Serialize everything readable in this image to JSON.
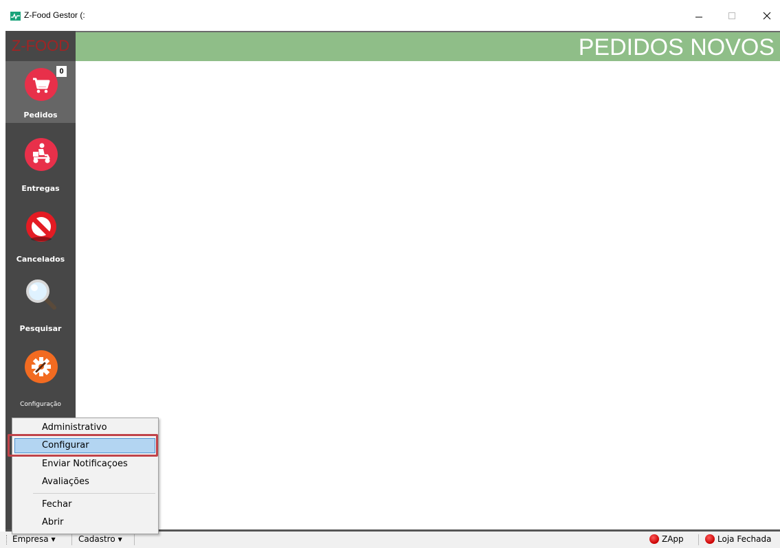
{
  "window": {
    "title": "Z-Food Gestor (:"
  },
  "brand": "Z-FOOD",
  "header": {
    "title": "PEDIDOS NOVOS"
  },
  "sidebar": {
    "items": [
      {
        "label": "Pedidos",
        "icon": "cart-icon",
        "badge": "0",
        "active": true
      },
      {
        "label": "Entregas",
        "icon": "delivery-scooter-icon"
      },
      {
        "label": "Cancelados",
        "icon": "cancel-icon"
      },
      {
        "label": "Pesquisar",
        "icon": "magnifier-icon"
      },
      {
        "label": "Configuração",
        "icon": "gear-wrench-icon"
      }
    ]
  },
  "menu": {
    "items": [
      "Administrativo",
      "Configurar",
      "Enviar Notificaçoes",
      "Avaliações",
      "Fechar",
      "Abrir"
    ],
    "highlighted": "Configurar"
  },
  "statusbar": {
    "empresa": "Empresa",
    "cadastro": "Cadastro",
    "zapp": "ZApp",
    "loja": "Loja Fechada"
  },
  "colors": {
    "header_bg": "#8fbe88",
    "sidebar_bg": "#474747",
    "brand_red": "#a02424",
    "icon_red": "#e8304a",
    "icon_orange": "#f26b21",
    "highlight": "#b3d5f2",
    "focus_outline": "#c0434a"
  }
}
